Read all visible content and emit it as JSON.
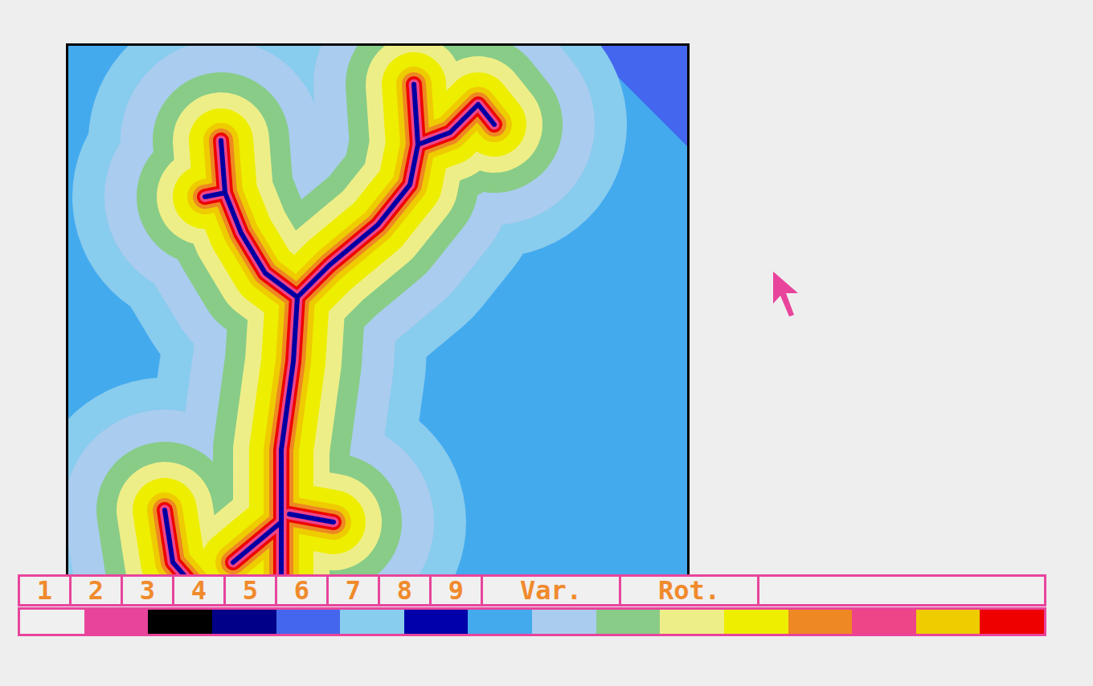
{
  "toolbar": {
    "buttons": [
      {
        "label": "1"
      },
      {
        "label": "2"
      },
      {
        "label": "3"
      },
      {
        "label": "4"
      },
      {
        "label": "5"
      },
      {
        "label": "6"
      },
      {
        "label": "7"
      },
      {
        "label": "8"
      },
      {
        "label": "9"
      },
      {
        "label": "Var."
      },
      {
        "label": "Rot."
      }
    ]
  },
  "palette": [
    {
      "color": "#f0f0f0"
    },
    {
      "color": "#e8449c"
    },
    {
      "color": "#000000"
    },
    {
      "color": "#000088"
    },
    {
      "color": "#4466ee"
    },
    {
      "color": "#88ccee"
    },
    {
      "color": "#0000aa"
    },
    {
      "color": "#44aaee"
    },
    {
      "color": "#aaccee"
    },
    {
      "color": "#88cc88"
    },
    {
      "color": "#eeee88"
    },
    {
      "color": "#eeee00"
    },
    {
      "color": "#ee8822"
    },
    {
      "color": "#ee4488"
    },
    {
      "color": "#eecc00"
    },
    {
      "color": "#ee0000"
    }
  ]
}
